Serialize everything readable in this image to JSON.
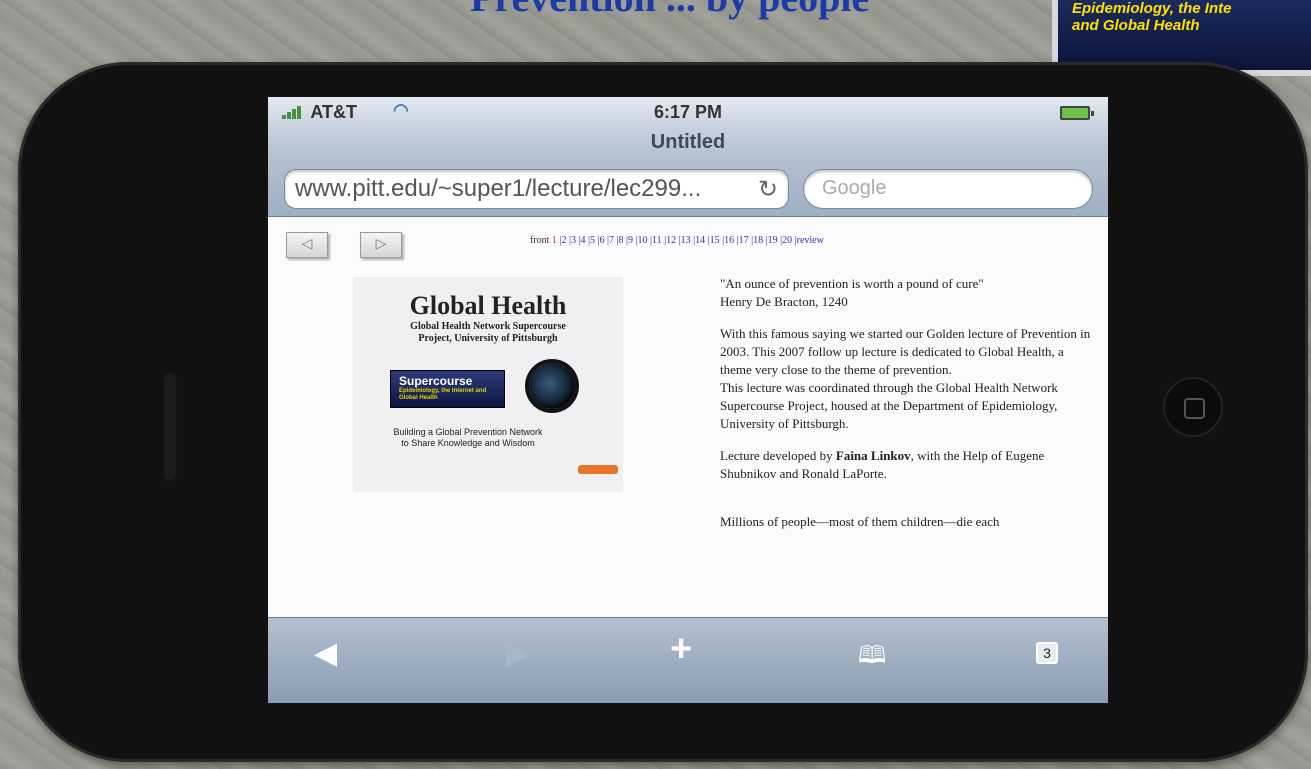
{
  "header": {
    "title": "Prevention ... by people",
    "cover_line1": "Epidemiology, the Inte",
    "cover_line2": "and Global Health"
  },
  "status_bar": {
    "carrier": "AT&T",
    "time": "6:17 PM"
  },
  "browser": {
    "page_title": "Untitled",
    "url": "www.pitt.edu/~super1/lecture/lec299...",
    "search_placeholder": "Google"
  },
  "page_nav": {
    "prefix": "front",
    "current": "1",
    "pages": "|2 |3 |4 |5 |6 |7 |8 |9 |10 |11 |12 |13 |14 |15 |16 |17 |18 |19 |20 |review"
  },
  "slide": {
    "title": "Global Health",
    "subtitle": "Global Health Network Supercourse",
    "subtitle2": "Project, University of Pittsburgh",
    "logo_text": "Supercourse",
    "logo_sub": "Epidemiology, the Internet and Global Health",
    "tagline": "Building a Global Prevention Network to Share Knowledge and Wisdom"
  },
  "article": {
    "quote": "\"An ounce of prevention is worth a pound of cure\"",
    "quote_author": "Henry De Bracton, 1240",
    "para1": "With this famous saying we started our Golden lecture of Prevention in 2003. This 2007 follow up lecture is dedicated to Global Health, a theme very close to the theme of prevention.",
    "para1b": "This lecture was coordinated through the Global Health Network Supercourse Project, housed at the Department of Epidemiology, University of Pittsburgh.",
    "para2_prefix": "Lecture developed by ",
    "para2_name": "Faina Linkov",
    "para2_suffix": ", with the Help of Eugene Shubnikov and Ronald LaPorte.",
    "para3": "Millions of people—most of them children—die each"
  },
  "toolbar": {
    "tab_count": "3"
  }
}
